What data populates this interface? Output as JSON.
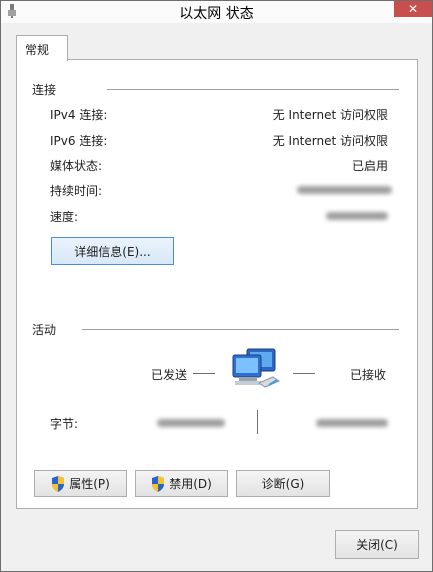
{
  "window": {
    "title": "以太网 状态",
    "close_glyph": "✕"
  },
  "tabs": [
    {
      "label": "常规"
    }
  ],
  "connection": {
    "section_title": "连接",
    "rows": [
      {
        "label": "IPv4 连接:",
        "value": "无 Internet 访问权限"
      },
      {
        "label": "IPv6 连接:",
        "value": "无 Internet 访问权限"
      },
      {
        "label": "媒体状态:",
        "value": "已启用"
      },
      {
        "label": "持续时间:",
        "value": ""
      },
      {
        "label": "速度:",
        "value": ""
      }
    ],
    "details_button": "详细信息(E)..."
  },
  "activity": {
    "section_title": "活动",
    "sent_label": "已发送",
    "received_label": "已接收",
    "bytes_label": "字节:"
  },
  "buttons": {
    "properties": "属性(P)",
    "disable": "禁用(D)",
    "diagnose": "诊断(G)",
    "close": "关闭(C)"
  },
  "icons": {
    "shield": "uac-shield-icon",
    "network": "network-computers-icon"
  },
  "colors": {
    "window_bg": "#f0f0f0",
    "panel_bg": "#ffffff",
    "close_red": "#c7504f",
    "focus_blue": "#4a8ed6"
  }
}
